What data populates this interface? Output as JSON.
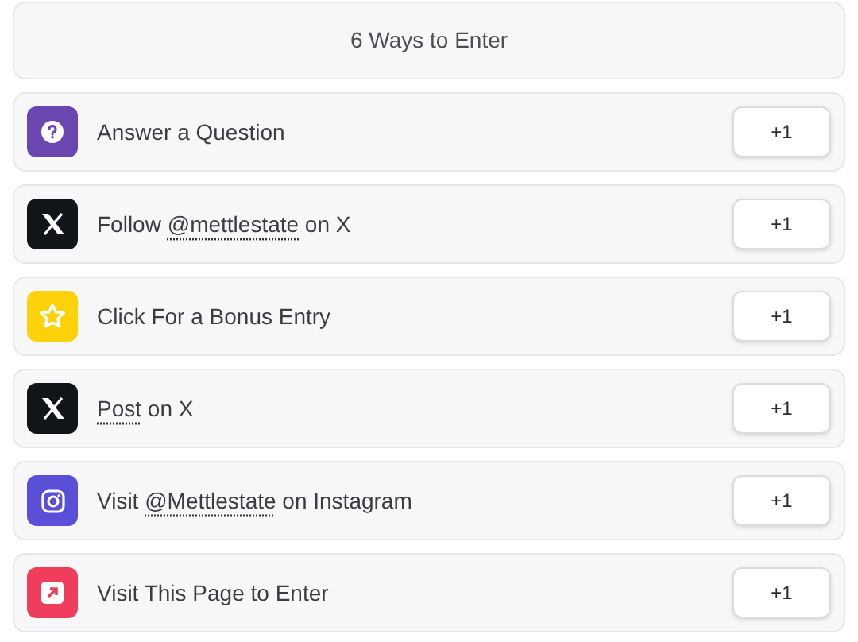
{
  "header": {
    "title": "6 Ways to Enter"
  },
  "entries": [
    {
      "kind": "question",
      "color": "#6b46b0",
      "segments": [
        {
          "kind": "text",
          "text": "Answer a Question"
        }
      ],
      "points": "+1"
    },
    {
      "kind": "x",
      "color": "#111418",
      "segments": [
        {
          "kind": "text",
          "text": "Follow "
        },
        {
          "kind": "link",
          "text": "@mettlestate"
        },
        {
          "kind": "text",
          "text": " on X"
        }
      ],
      "points": "+1"
    },
    {
      "kind": "star",
      "color": "#fdd20a",
      "segments": [
        {
          "kind": "text",
          "text": "Click For a Bonus Entry"
        }
      ],
      "points": "+1"
    },
    {
      "kind": "x",
      "color": "#111418",
      "segments": [
        {
          "kind": "link",
          "text": "Post"
        },
        {
          "kind": "text",
          "text": " on X"
        }
      ],
      "points": "+1"
    },
    {
      "kind": "instagram",
      "color": "#5b4fd8",
      "segments": [
        {
          "kind": "text",
          "text": "Visit "
        },
        {
          "kind": "link",
          "text": "@Mettlestate"
        },
        {
          "kind": "text",
          "text": " on Instagram"
        }
      ],
      "points": "+1"
    },
    {
      "kind": "visit",
      "color": "#ef3e5c",
      "segments": [
        {
          "kind": "text",
          "text": "Visit This Page to Enter"
        }
      ],
      "points": "+1"
    }
  ]
}
